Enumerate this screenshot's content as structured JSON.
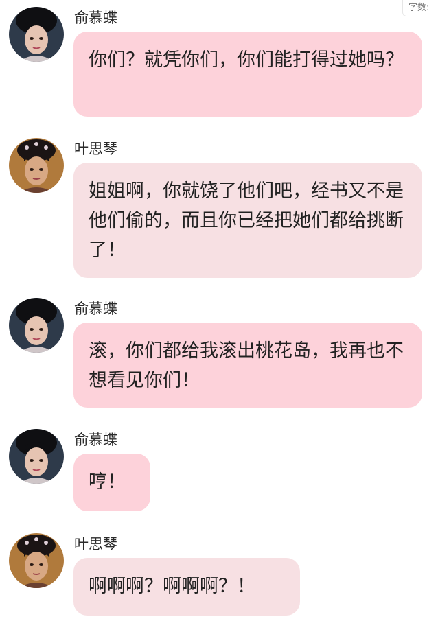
{
  "counter": {
    "label": "字数:"
  },
  "messages": [
    {
      "speaker": "俞慕蝶",
      "avatar": "yu-mudie-avatar",
      "text": "你们？就凭你们，你们能打得过她吗？"
    },
    {
      "speaker": "叶思琴",
      "avatar": "ye-siqin-avatar",
      "text": "姐姐啊，你就饶了他们吧，经书又不是他们偷的，而且你已经把她们都给挑断了！"
    },
    {
      "speaker": "俞慕蝶",
      "avatar": "yu-mudie-avatar",
      "text": "滚，你们都给我滚出桃花岛，我再也不想看见你们！"
    },
    {
      "speaker": "俞慕蝶",
      "avatar": "yu-mudie-avatar",
      "text": "哼！"
    },
    {
      "speaker": "叶思琴",
      "avatar": "ye-siqin-avatar",
      "text": "啊啊啊？啊啊啊？！"
    }
  ],
  "colors": {
    "bubble_pink": "#fdd2da",
    "bubble_grey": "#f7e0e3",
    "name_text": "#2b2b2b",
    "message_text": "#222222"
  }
}
